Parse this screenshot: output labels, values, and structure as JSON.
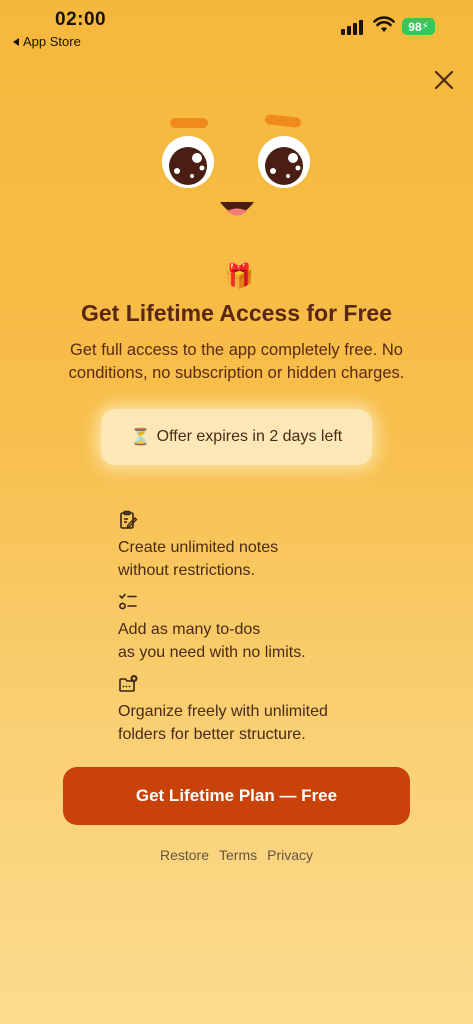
{
  "status_bar": {
    "time": "02:00",
    "back_label": "App Store",
    "battery": "98"
  },
  "hero": {
    "gift_emoji": "🎁",
    "title": "Get Lifetime Access for Free",
    "subtitle": "Get full access to the app completely free. No conditions, no subscription or hidden charges."
  },
  "offer": {
    "icon_emoji": "⏳",
    "text": "Offer expires in 2 days left"
  },
  "features": [
    {
      "icon": "notes-edit-icon",
      "line1": "Create unlimited notes",
      "line2": "without restrictions."
    },
    {
      "icon": "todo-list-icon",
      "line1": "Add as many to-dos",
      "line2": "as you need with no limits."
    },
    {
      "icon": "folder-add-icon",
      "line1": "Organize freely with unlimited",
      "line2": "folders for better structure."
    }
  ],
  "cta": {
    "label": "Get Lifetime Plan — Free"
  },
  "footer": {
    "restore": "Restore",
    "terms": "Terms",
    "privacy": "Privacy"
  },
  "colors": {
    "background_top": "#F6B83C",
    "background_bottom": "#FBDC8E",
    "cta": "#C8420A",
    "title": "#5a2616",
    "battery": "#34C759"
  }
}
